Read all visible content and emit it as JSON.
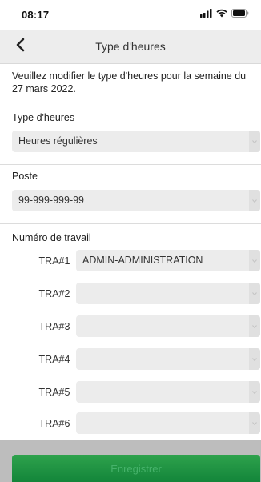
{
  "status_bar": {
    "time": "08:17",
    "icons": [
      "signal-icon",
      "wifi-icon",
      "battery-icon"
    ]
  },
  "nav": {
    "title": "Type d'heures",
    "back_icon": "chevron-left-icon"
  },
  "intro": "Veuillez modifier le type d'heures pour la semaine du 27 mars 2022.",
  "hour_type": {
    "label": "Type d'heures",
    "value": "Heures régulières"
  },
  "poste": {
    "label": "Poste",
    "value": "99-999-999-99"
  },
  "work_number": {
    "label": "Numéro de travail",
    "rows": [
      {
        "label": "TRA#1",
        "value": "ADMIN-ADMINISTRATION"
      },
      {
        "label": "TRA#2",
        "value": ""
      },
      {
        "label": "TRA#3",
        "value": ""
      },
      {
        "label": "TRA#4",
        "value": ""
      },
      {
        "label": "TRA#5",
        "value": ""
      },
      {
        "label": "TRA#6",
        "value": ""
      }
    ]
  },
  "footer": {
    "save_label": "Enregistrer"
  },
  "colors": {
    "save_button": "#1a8f40",
    "footer_background": "#bdbdbd",
    "nav_background": "#ededed"
  }
}
